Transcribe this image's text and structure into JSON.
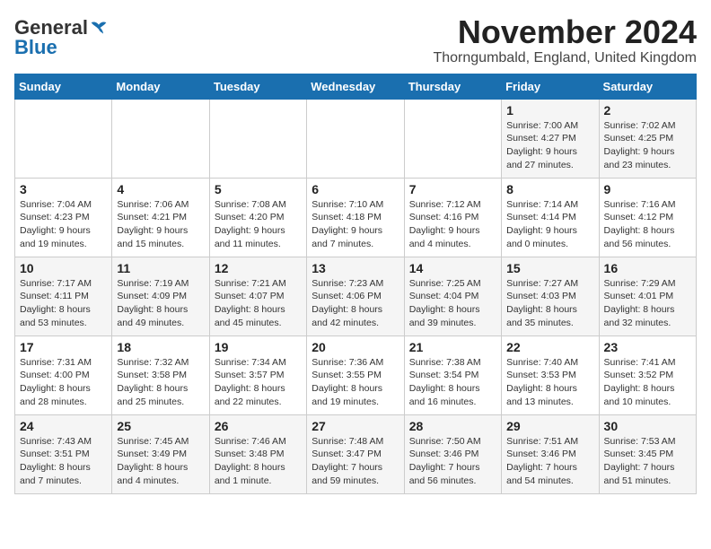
{
  "logo": {
    "general": "General",
    "blue": "Blue"
  },
  "title": "November 2024",
  "location": "Thorngumbald, England, United Kingdom",
  "days_header": [
    "Sunday",
    "Monday",
    "Tuesday",
    "Wednesday",
    "Thursday",
    "Friday",
    "Saturday"
  ],
  "weeks": [
    [
      {
        "day": "",
        "info": ""
      },
      {
        "day": "",
        "info": ""
      },
      {
        "day": "",
        "info": ""
      },
      {
        "day": "",
        "info": ""
      },
      {
        "day": "",
        "info": ""
      },
      {
        "day": "1",
        "info": "Sunrise: 7:00 AM\nSunset: 4:27 PM\nDaylight: 9 hours\nand 27 minutes."
      },
      {
        "day": "2",
        "info": "Sunrise: 7:02 AM\nSunset: 4:25 PM\nDaylight: 9 hours\nand 23 minutes."
      }
    ],
    [
      {
        "day": "3",
        "info": "Sunrise: 7:04 AM\nSunset: 4:23 PM\nDaylight: 9 hours\nand 19 minutes."
      },
      {
        "day": "4",
        "info": "Sunrise: 7:06 AM\nSunset: 4:21 PM\nDaylight: 9 hours\nand 15 minutes."
      },
      {
        "day": "5",
        "info": "Sunrise: 7:08 AM\nSunset: 4:20 PM\nDaylight: 9 hours\nand 11 minutes."
      },
      {
        "day": "6",
        "info": "Sunrise: 7:10 AM\nSunset: 4:18 PM\nDaylight: 9 hours\nand 7 minutes."
      },
      {
        "day": "7",
        "info": "Sunrise: 7:12 AM\nSunset: 4:16 PM\nDaylight: 9 hours\nand 4 minutes."
      },
      {
        "day": "8",
        "info": "Sunrise: 7:14 AM\nSunset: 4:14 PM\nDaylight: 9 hours\nand 0 minutes."
      },
      {
        "day": "9",
        "info": "Sunrise: 7:16 AM\nSunset: 4:12 PM\nDaylight: 8 hours\nand 56 minutes."
      }
    ],
    [
      {
        "day": "10",
        "info": "Sunrise: 7:17 AM\nSunset: 4:11 PM\nDaylight: 8 hours\nand 53 minutes."
      },
      {
        "day": "11",
        "info": "Sunrise: 7:19 AM\nSunset: 4:09 PM\nDaylight: 8 hours\nand 49 minutes."
      },
      {
        "day": "12",
        "info": "Sunrise: 7:21 AM\nSunset: 4:07 PM\nDaylight: 8 hours\nand 45 minutes."
      },
      {
        "day": "13",
        "info": "Sunrise: 7:23 AM\nSunset: 4:06 PM\nDaylight: 8 hours\nand 42 minutes."
      },
      {
        "day": "14",
        "info": "Sunrise: 7:25 AM\nSunset: 4:04 PM\nDaylight: 8 hours\nand 39 minutes."
      },
      {
        "day": "15",
        "info": "Sunrise: 7:27 AM\nSunset: 4:03 PM\nDaylight: 8 hours\nand 35 minutes."
      },
      {
        "day": "16",
        "info": "Sunrise: 7:29 AM\nSunset: 4:01 PM\nDaylight: 8 hours\nand 32 minutes."
      }
    ],
    [
      {
        "day": "17",
        "info": "Sunrise: 7:31 AM\nSunset: 4:00 PM\nDaylight: 8 hours\nand 28 minutes."
      },
      {
        "day": "18",
        "info": "Sunrise: 7:32 AM\nSunset: 3:58 PM\nDaylight: 8 hours\nand 25 minutes."
      },
      {
        "day": "19",
        "info": "Sunrise: 7:34 AM\nSunset: 3:57 PM\nDaylight: 8 hours\nand 22 minutes."
      },
      {
        "day": "20",
        "info": "Sunrise: 7:36 AM\nSunset: 3:55 PM\nDaylight: 8 hours\nand 19 minutes."
      },
      {
        "day": "21",
        "info": "Sunrise: 7:38 AM\nSunset: 3:54 PM\nDaylight: 8 hours\nand 16 minutes."
      },
      {
        "day": "22",
        "info": "Sunrise: 7:40 AM\nSunset: 3:53 PM\nDaylight: 8 hours\nand 13 minutes."
      },
      {
        "day": "23",
        "info": "Sunrise: 7:41 AM\nSunset: 3:52 PM\nDaylight: 8 hours\nand 10 minutes."
      }
    ],
    [
      {
        "day": "24",
        "info": "Sunrise: 7:43 AM\nSunset: 3:51 PM\nDaylight: 8 hours\nand 7 minutes."
      },
      {
        "day": "25",
        "info": "Sunrise: 7:45 AM\nSunset: 3:49 PM\nDaylight: 8 hours\nand 4 minutes."
      },
      {
        "day": "26",
        "info": "Sunrise: 7:46 AM\nSunset: 3:48 PM\nDaylight: 8 hours\nand 1 minute."
      },
      {
        "day": "27",
        "info": "Sunrise: 7:48 AM\nSunset: 3:47 PM\nDaylight: 7 hours\nand 59 minutes."
      },
      {
        "day": "28",
        "info": "Sunrise: 7:50 AM\nSunset: 3:46 PM\nDaylight: 7 hours\nand 56 minutes."
      },
      {
        "day": "29",
        "info": "Sunrise: 7:51 AM\nSunset: 3:46 PM\nDaylight: 7 hours\nand 54 minutes."
      },
      {
        "day": "30",
        "info": "Sunrise: 7:53 AM\nSunset: 3:45 PM\nDaylight: 7 hours\nand 51 minutes."
      }
    ]
  ]
}
